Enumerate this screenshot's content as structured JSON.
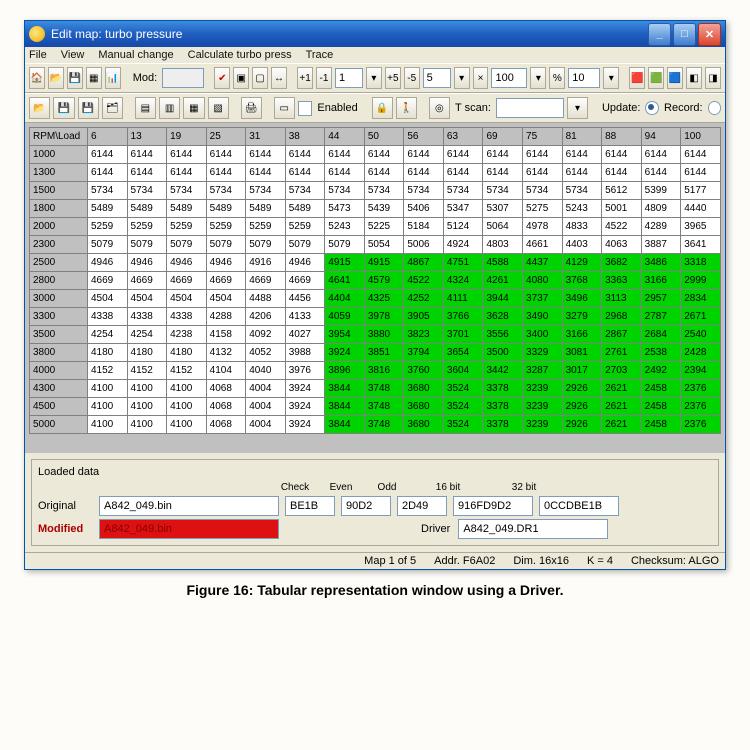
{
  "window": {
    "title": "Edit map: turbo pressure"
  },
  "menu": [
    "File",
    "View",
    "Manual change",
    "Calculate turbo press",
    "Trace"
  ],
  "toolbar1": {
    "mod_label": "Mod:",
    "mod_value": "",
    "spin1": "1",
    "spin2": "5",
    "spin3": "100",
    "spin4": "10"
  },
  "toolbar2": {
    "enabled_label": "Enabled",
    "tscan_label": "T scan:",
    "tscan_value": "",
    "update_label": "Update:",
    "record_label": "Record:"
  },
  "table": {
    "corner": "RPM\\Load",
    "cols": [
      "6",
      "13",
      "19",
      "25",
      "31",
      "38",
      "44",
      "50",
      "56",
      "63",
      "69",
      "75",
      "81",
      "88",
      "94",
      "100"
    ],
    "rows": [
      {
        "hdr": "1000",
        "cells": [
          "6144",
          "6144",
          "6144",
          "6144",
          "6144",
          "6144",
          "6144",
          "6144",
          "6144",
          "6144",
          "6144",
          "6144",
          "6144",
          "6144",
          "6144",
          "6144"
        ],
        "hl": []
      },
      {
        "hdr": "1300",
        "cells": [
          "6144",
          "6144",
          "6144",
          "6144",
          "6144",
          "6144",
          "6144",
          "6144",
          "6144",
          "6144",
          "6144",
          "6144",
          "6144",
          "6144",
          "6144",
          "6144"
        ],
        "hl": []
      },
      {
        "hdr": "1500",
        "cells": [
          "5734",
          "5734",
          "5734",
          "5734",
          "5734",
          "5734",
          "5734",
          "5734",
          "5734",
          "5734",
          "5734",
          "5734",
          "5734",
          "5612",
          "5399",
          "5177"
        ],
        "hl": []
      },
      {
        "hdr": "1800",
        "cells": [
          "5489",
          "5489",
          "5489",
          "5489",
          "5489",
          "5489",
          "5473",
          "5439",
          "5406",
          "5347",
          "5307",
          "5275",
          "5243",
          "5001",
          "4809",
          "4440"
        ],
        "hl": []
      },
      {
        "hdr": "2000",
        "cells": [
          "5259",
          "5259",
          "5259",
          "5259",
          "5259",
          "5259",
          "5243",
          "5225",
          "5184",
          "5124",
          "5064",
          "4978",
          "4833",
          "4522",
          "4289",
          "3965"
        ],
        "hl": []
      },
      {
        "hdr": "2300",
        "cells": [
          "5079",
          "5079",
          "5079",
          "5079",
          "5079",
          "5079",
          "5079",
          "5054",
          "5006",
          "4924",
          "4803",
          "4661",
          "4403",
          "4063",
          "3887",
          "3641"
        ],
        "hl": []
      },
      {
        "hdr": "2500",
        "cells": [
          "4946",
          "4946",
          "4946",
          "4946",
          "4916",
          "4946",
          "4915",
          "4915",
          "4867",
          "4751",
          "4588",
          "4437",
          "4129",
          "3682",
          "3486",
          "3318"
        ],
        "hl": [
          6,
          7,
          8,
          9,
          10,
          11,
          12,
          13,
          14,
          15
        ]
      },
      {
        "hdr": "2800",
        "cells": [
          "4669",
          "4669",
          "4669",
          "4669",
          "4669",
          "4669",
          "4641",
          "4579",
          "4522",
          "4324",
          "4261",
          "4080",
          "3768",
          "3363",
          "3166",
          "2999"
        ],
        "hl": [
          6,
          7,
          8,
          9,
          10,
          11,
          12,
          13,
          14,
          15
        ]
      },
      {
        "hdr": "3000",
        "cells": [
          "4504",
          "4504",
          "4504",
          "4504",
          "4488",
          "4456",
          "4404",
          "4325",
          "4252",
          "4111",
          "3944",
          "3737",
          "3496",
          "3113",
          "2957",
          "2834"
        ],
        "hl": [
          6,
          7,
          8,
          9,
          10,
          11,
          12,
          13,
          14,
          15
        ]
      },
      {
        "hdr": "3300",
        "cells": [
          "4338",
          "4338",
          "4338",
          "4288",
          "4206",
          "4133",
          "4059",
          "3978",
          "3905",
          "3766",
          "3628",
          "3490",
          "3279",
          "2968",
          "2787",
          "2671"
        ],
        "hl": [
          6,
          7,
          8,
          9,
          10,
          11,
          12,
          13,
          14,
          15
        ]
      },
      {
        "hdr": "3500",
        "cells": [
          "4254",
          "4254",
          "4238",
          "4158",
          "4092",
          "4027",
          "3954",
          "3880",
          "3823",
          "3701",
          "3556",
          "3400",
          "3166",
          "2867",
          "2684",
          "2540"
        ],
        "hl": [
          6,
          7,
          8,
          9,
          10,
          11,
          12,
          13,
          14,
          15
        ]
      },
      {
        "hdr": "3800",
        "cells": [
          "4180",
          "4180",
          "4180",
          "4132",
          "4052",
          "3988",
          "3924",
          "3851",
          "3794",
          "3654",
          "3500",
          "3329",
          "3081",
          "2761",
          "2538",
          "2428"
        ],
        "hl": [
          6,
          7,
          8,
          9,
          10,
          11,
          12,
          13,
          14,
          15
        ]
      },
      {
        "hdr": "4000",
        "cells": [
          "4152",
          "4152",
          "4152",
          "4104",
          "4040",
          "3976",
          "3896",
          "3816",
          "3760",
          "3604",
          "3442",
          "3287",
          "3017",
          "2703",
          "2492",
          "2394"
        ],
        "hl": [
          6,
          7,
          8,
          9,
          10,
          11,
          12,
          13,
          14,
          15
        ]
      },
      {
        "hdr": "4300",
        "cells": [
          "4100",
          "4100",
          "4100",
          "4068",
          "4004",
          "3924",
          "3844",
          "3748",
          "3680",
          "3524",
          "3378",
          "3239",
          "2926",
          "2621",
          "2458",
          "2376"
        ],
        "hl": [
          6,
          7,
          8,
          9,
          10,
          11,
          12,
          13,
          14,
          15
        ]
      },
      {
        "hdr": "4500",
        "cells": [
          "4100",
          "4100",
          "4100",
          "4068",
          "4004",
          "3924",
          "3844",
          "3748",
          "3680",
          "3524",
          "3378",
          "3239",
          "2926",
          "2621",
          "2458",
          "2376"
        ],
        "hl": [
          6,
          7,
          8,
          9,
          10,
          11,
          12,
          13,
          14,
          15
        ]
      },
      {
        "hdr": "5000",
        "cells": [
          "4100",
          "4100",
          "4100",
          "4068",
          "4004",
          "3924",
          "3844",
          "3748",
          "3680",
          "3524",
          "3378",
          "3239",
          "2926",
          "2621",
          "2458",
          "2376"
        ],
        "hl": [
          6,
          7,
          8,
          9,
          10,
          11,
          12,
          13,
          14,
          15
        ]
      }
    ]
  },
  "bottom": {
    "group_label": "Loaded data",
    "original_label": "Original",
    "original_value": "A842_049.bin",
    "modified_label": "Modified",
    "modified_value": "A842_049.bin",
    "check_label": "Check",
    "check_value": "BE1B",
    "even_label": "Even",
    "even_value": "90D2",
    "odd_label": "Odd",
    "odd_value": "2D49",
    "b16_label": "16 bit",
    "b16_value": "916FD9D2",
    "b32_label": "32 bit",
    "b32_value": "0CCDBE1B",
    "driver_label": "Driver",
    "driver_value": "A842_049.DR1"
  },
  "status": {
    "map": "Map 1 of 5",
    "addr": "Addr. F6A02",
    "dim": "Dim. 16x16",
    "k": "K = 4",
    "chk": "Checksum: ALGO"
  },
  "caption": "Figure 16: Tabular representation window using a Driver."
}
